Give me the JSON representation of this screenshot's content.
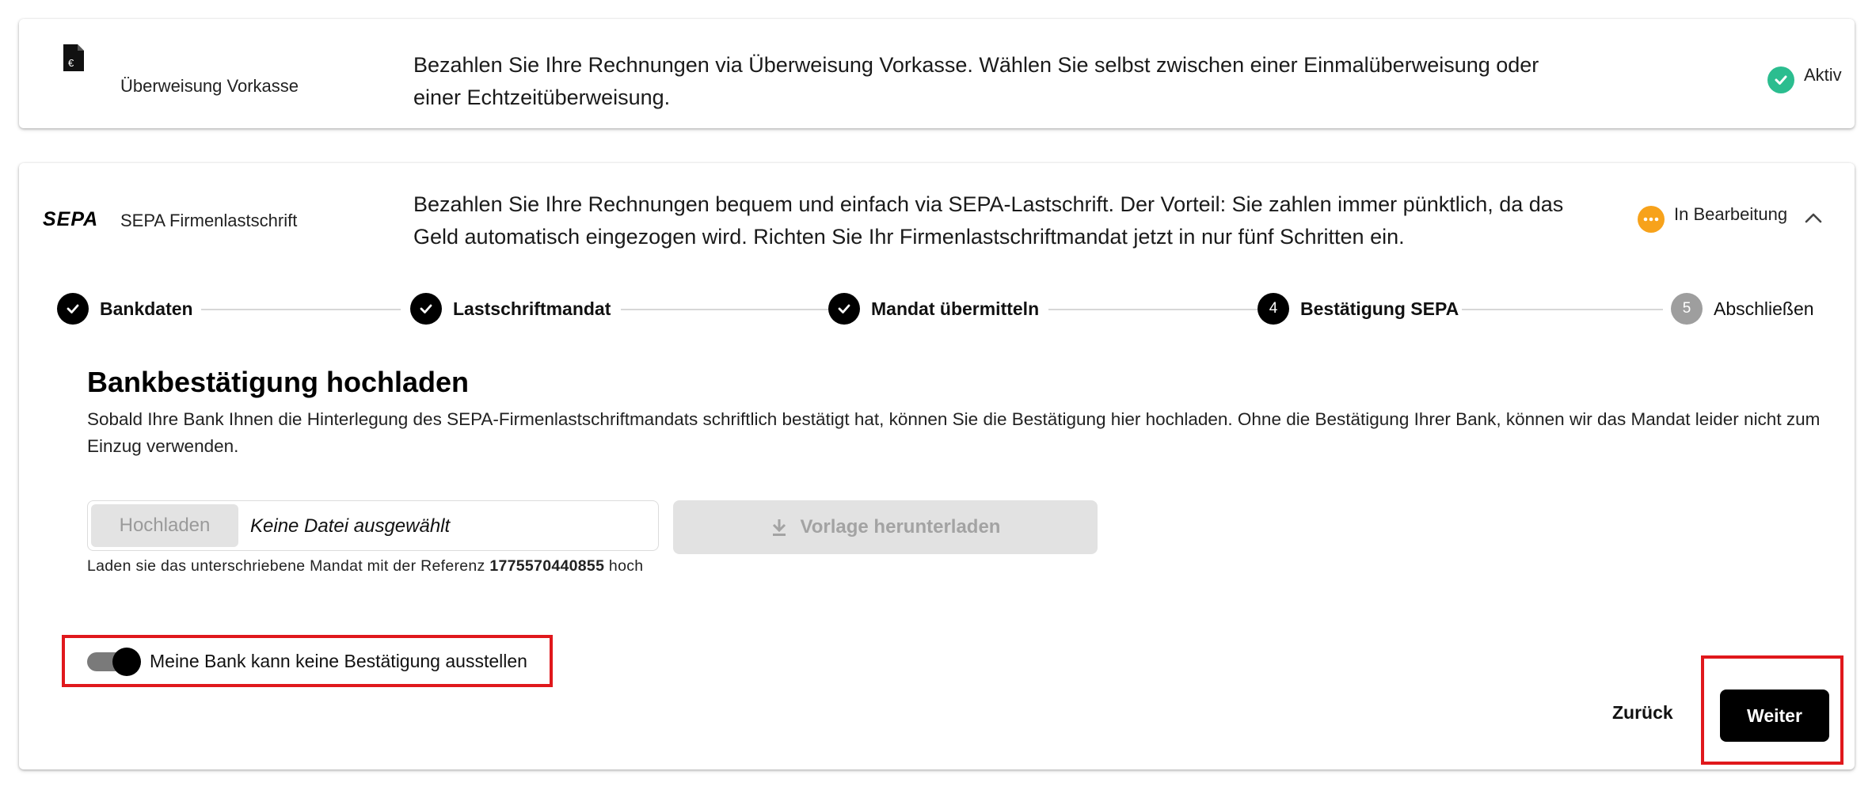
{
  "payment_methods": [
    {
      "icon": "euro-document-icon",
      "name": "Überweisung Vorkasse",
      "description": "Bezahlen Sie Ihre Rechnungen via Überweisung Vorkasse. Wählen Sie selbst zwischen einer Einmalüberweisung oder einer Echtzeitüberweisung.",
      "status": "Aktiv",
      "status_color": "#2bbd8f"
    },
    {
      "icon": "sepa-logo-icon",
      "logo_text": "SEPA",
      "name": "SEPA Firmenlastschrift",
      "description": "Bezahlen Sie Ihre Rechnungen bequem und einfach via SEPA-Lastschrift. Der Vorteil: Sie zahlen immer pünktlich, da das Geld automatisch eingezogen wird. Richten Sie Ihr Firmenlastschriftmandat jetzt in nur fünf Schritten ein.",
      "status": "In Bearbeitung",
      "status_color": "#f7a21b"
    }
  ],
  "stepper": {
    "steps": [
      {
        "label": "Bankdaten",
        "state": "done"
      },
      {
        "label": "Lastschriftmandat",
        "state": "done"
      },
      {
        "label": "Mandat übermitteln",
        "state": "done"
      },
      {
        "label": "Bestätigung SEPA",
        "state": "active",
        "number": "4"
      },
      {
        "label": "Abschließen",
        "state": "pending",
        "number": "5"
      }
    ]
  },
  "upload": {
    "title": "Bankbestätigung hochladen",
    "description": "Sobald Ihre Bank Ihnen die Hinterlegung des SEPA-Firmenlastschriftmandats schriftlich bestätigt hat, können Sie die Bestätigung hier hochladen. Ohne die Bestätigung Ihrer Bank, können wir das Mandat leider nicht zum Einzug verwenden.",
    "upload_button": "Hochladen",
    "file_name": "Keine Datei ausgewählt",
    "download_button": "Vorlage herunterladen",
    "hint_prefix": "Laden sie das unterschriebene Mandat mit der Referenz ",
    "reference": "1775570440855",
    "hint_suffix": " hoch"
  },
  "toggle": {
    "label": "Meine Bank kann keine Bestätigung ausstellen",
    "checked": true
  },
  "actions": {
    "back_label": "Zurück",
    "next_label": "Weiter"
  },
  "colors": {
    "highlight": "#e0181c",
    "primary": "#000000"
  }
}
